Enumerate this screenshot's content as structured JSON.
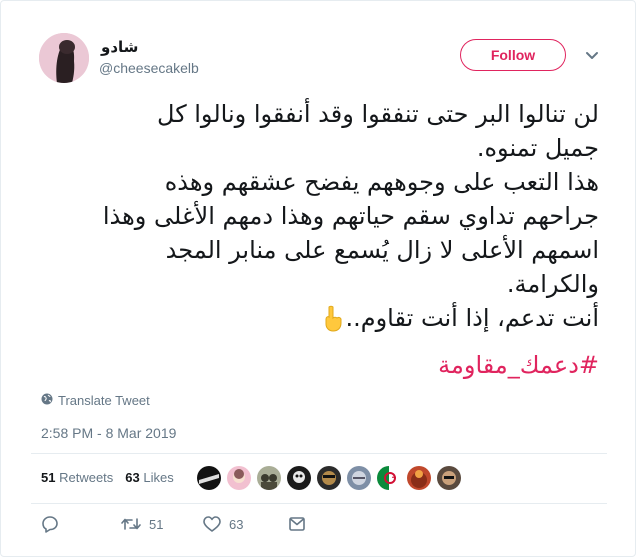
{
  "user": {
    "name": "شادو",
    "handle": "@cheesecakelb"
  },
  "follow_label": "Follow",
  "tweet": {
    "lines": [
      "لن تنالوا البر حتى تنفقوا وقد أنفقوا ونالوا كل",
      "جميل تمنوه.",
      "هذا التعب على وجوههم يفضح عشقهم وهذه",
      "جراحهم تداوي سقم حياتهم وهذا دمهم الأغلى وهذا",
      "اسمهم الأعلى لا زال يُسمع على منابر المجد",
      "والكرامة.",
      "أنت تدعم، إذا أنت تقاوم.."
    ],
    "emoji": "pointing-down-emoji",
    "hashtag": "#دعمك_مقاومة"
  },
  "translate_label": "Translate Tweet",
  "timestamp": "2:58 PM - 8 Mar 2019",
  "stats": {
    "retweets_count": "51",
    "retweets_label": "Retweets",
    "likes_count": "63",
    "likes_label": "Likes"
  },
  "actions": {
    "retweet_count": "51",
    "like_count": "63"
  },
  "colors": {
    "accent": "#e0245e",
    "muted": "#657786",
    "text": "#14171a",
    "divider": "#e6ecf0"
  }
}
